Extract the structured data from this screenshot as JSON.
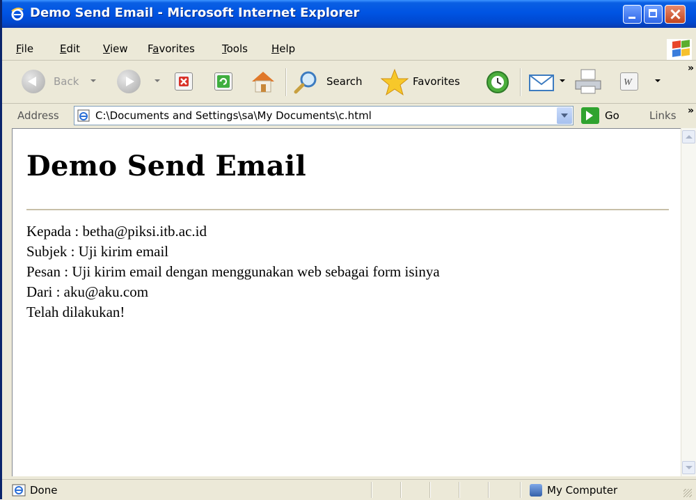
{
  "window": {
    "title": "Demo Send Email - Microsoft Internet Explorer"
  },
  "menu": {
    "items": [
      {
        "label": "File",
        "u": "F"
      },
      {
        "label": "Edit",
        "u": "E"
      },
      {
        "label": "View",
        "u": "V"
      },
      {
        "label": "Favorites",
        "u": "a"
      },
      {
        "label": "Tools",
        "u": "T"
      },
      {
        "label": "Help",
        "u": "H"
      }
    ]
  },
  "toolbar": {
    "back_label": "Back",
    "search_label": "Search",
    "favorites_label": "Favorites",
    "overflow": "»"
  },
  "address": {
    "label": "Address",
    "url": "C:\\Documents and Settings\\sa\\My Documents\\c.html",
    "go_label": "Go",
    "links_label": "Links",
    "links_overflow": "»"
  },
  "page": {
    "heading": "Demo Send Email",
    "lines": [
      "Kepada : betha@piksi.itb.ac.id",
      "Subjek : Uji kirim email",
      "Pesan : Uji kirim email dengan menggunakan web sebagai form isinya",
      "Dari : aku@aku.com",
      "Telah dilakukan!"
    ]
  },
  "status": {
    "text": "Done",
    "zone": "My Computer"
  },
  "colors": {
    "titlebar": "#0054E3",
    "chrome": "#ECE9D8"
  }
}
